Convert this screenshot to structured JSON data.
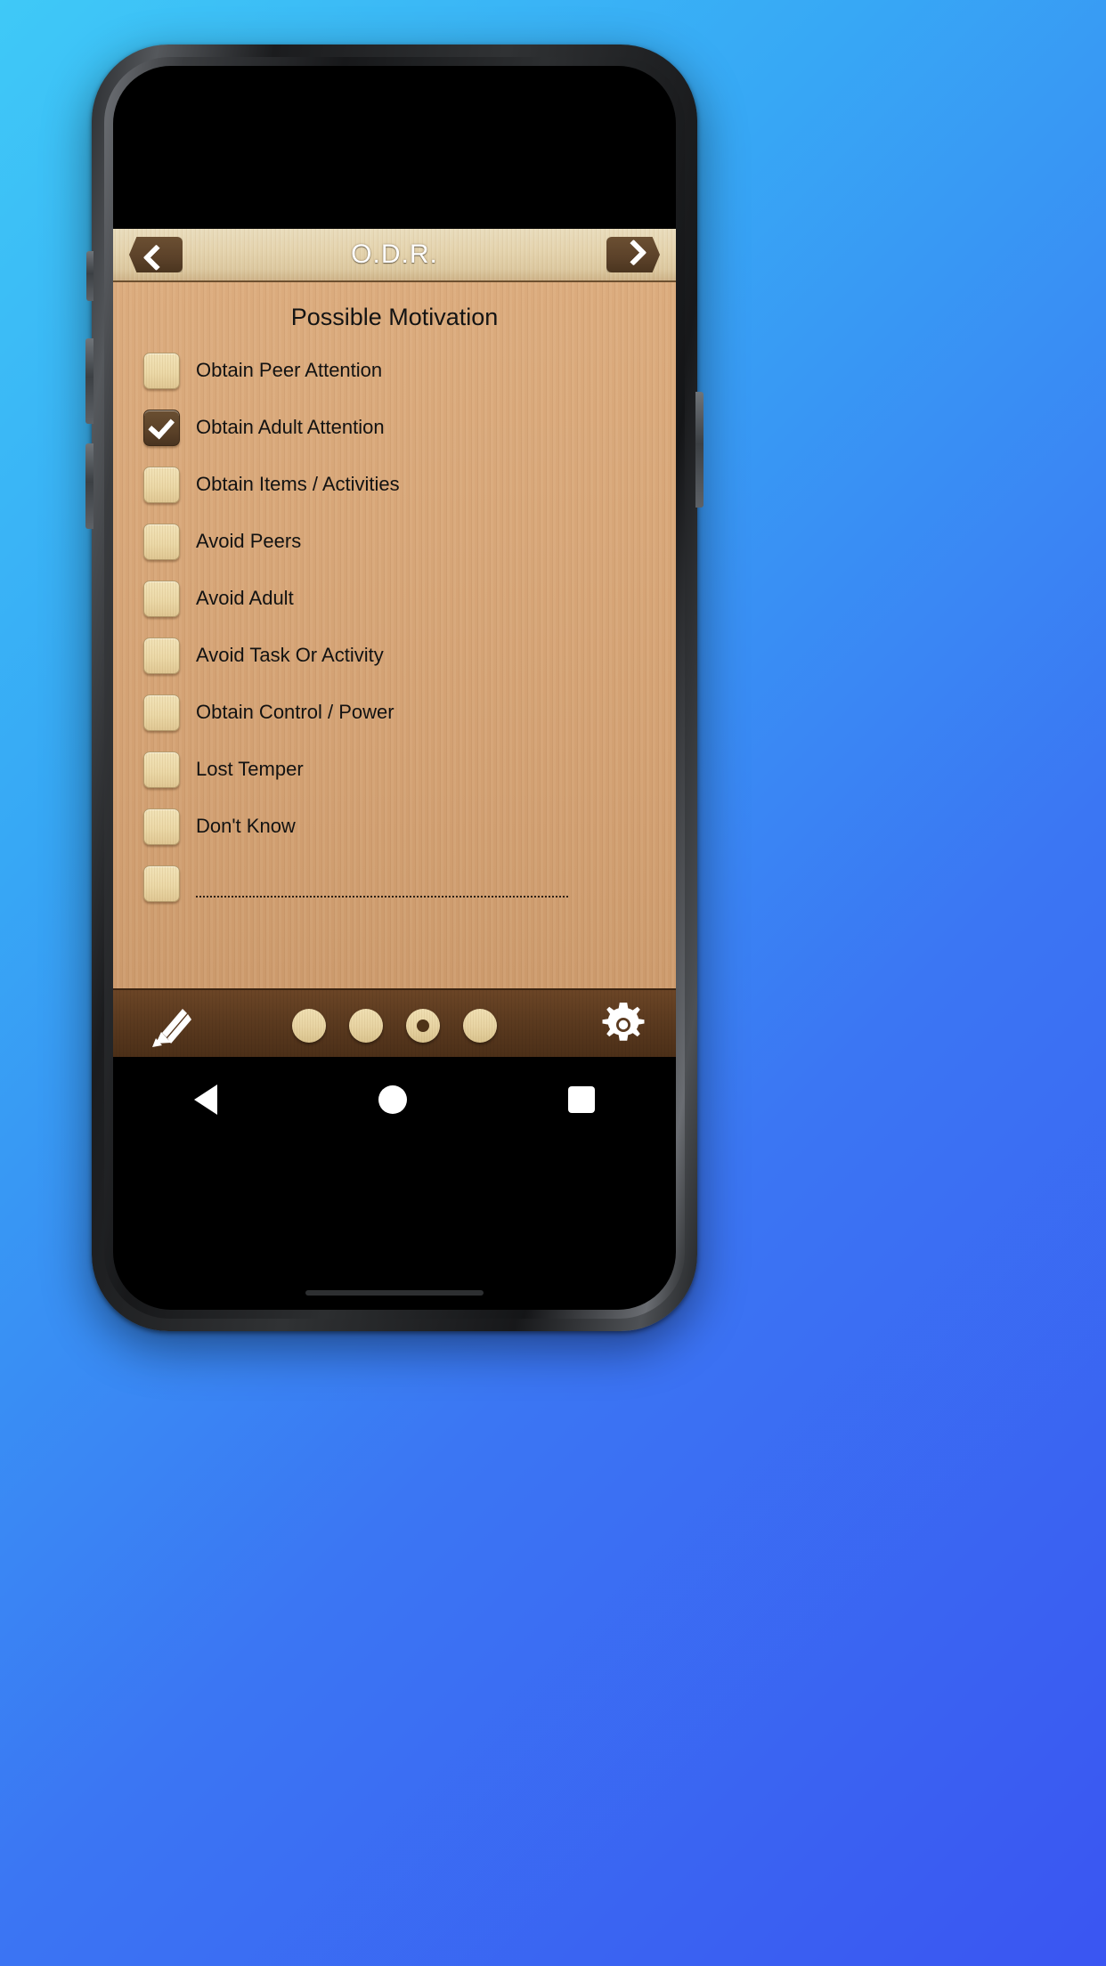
{
  "background": {
    "gradient_start": "#3fc9f7",
    "gradient_end": "#3a55f2"
  },
  "device": {
    "frame_color": "#2b2d30",
    "screen_background": "#000000"
  },
  "app": {
    "header": {
      "title": "O.D.R.",
      "back_icon": "chevron-left-icon",
      "next_icon": "chevron-right-icon",
      "wood_color": "#e4d3ad"
    },
    "body": {
      "heading": "Possible Motivation",
      "wood_color": "#d7a678",
      "items": [
        {
          "label": "Obtain Peer Attention",
          "checked": false
        },
        {
          "label": "Obtain Adult Attention",
          "checked": true
        },
        {
          "label": "Obtain Items / Activities",
          "checked": false
        },
        {
          "label": "Avoid Peers",
          "checked": false
        },
        {
          "label": "Avoid Adult",
          "checked": false
        },
        {
          "label": "Avoid Task Or Activity",
          "checked": false
        },
        {
          "label": "Obtain Control / Power",
          "checked": false
        },
        {
          "label": "Lost Temper",
          "checked": false
        },
        {
          "label": "Don't Know",
          "checked": false
        }
      ],
      "custom_entry": {
        "label": "",
        "placeholder": "",
        "checked": false,
        "has_dotted_line": true
      }
    },
    "toolbar": {
      "edit_icon": "pencil-icon",
      "settings_icon": "gear-icon",
      "wood_color": "#5b3a1f",
      "page_dots": {
        "count": 4,
        "active_index": 2
      }
    }
  },
  "android_nav": {
    "back_icon": "triangle-back-icon",
    "home_icon": "circle-home-icon",
    "recents_icon": "square-recents-icon"
  }
}
